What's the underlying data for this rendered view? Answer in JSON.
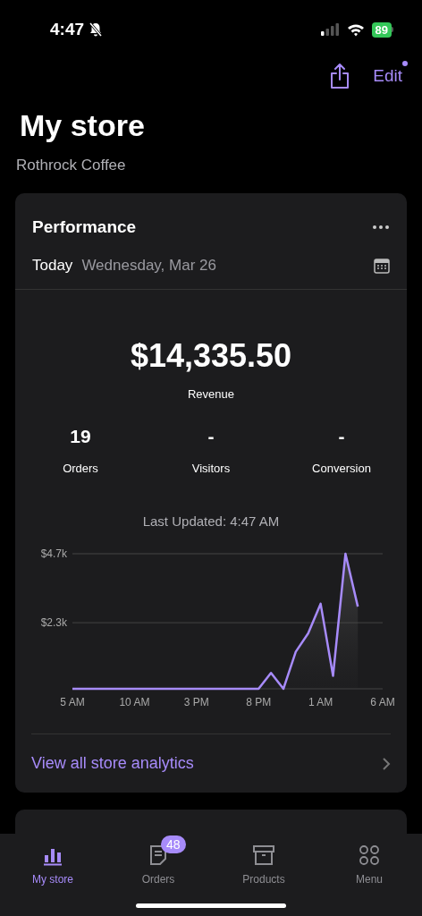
{
  "status_bar": {
    "time": "4:47",
    "battery": "89"
  },
  "header": {
    "edit": "Edit",
    "edit_dot": true
  },
  "title": "My store",
  "subtitle": "Rothrock Coffee",
  "performance": {
    "title": "Performance",
    "period": "Today",
    "date": "Wednesday, Mar 26",
    "revenue": "$14,335.50",
    "revenue_label": "Revenue",
    "stats": [
      {
        "value": "19",
        "label": "Orders"
      },
      {
        "value": "-",
        "label": "Visitors"
      },
      {
        "value": "-",
        "label": "Conversion"
      }
    ],
    "last_updated": "Last Updated: 4:47 AM",
    "chart_data": {
      "type": "area",
      "categories": [
        "5 AM",
        null,
        null,
        null,
        null,
        "10 AM",
        null,
        null,
        null,
        null,
        "3 PM",
        null,
        null,
        null,
        null,
        "8 PM",
        null,
        null,
        null,
        null,
        "1 AM",
        null,
        null,
        null,
        null,
        "6 AM"
      ],
      "ylim": [
        0,
        4700
      ],
      "yticks": [
        {
          "value": 2300,
          "label": "$2.3k"
        },
        {
          "value": 4700,
          "label": "$4.7k"
        }
      ],
      "series": [
        {
          "color": "#a78bfa",
          "values": [
            0,
            0,
            0,
            0,
            0,
            0,
            0,
            0,
            0,
            0,
            0,
            0,
            0,
            0,
            0,
            0,
            550,
            0,
            1290,
            1930,
            2960,
            450,
            4700,
            2860,
            null,
            null
          ]
        }
      ]
    },
    "link": "View all store analytics"
  },
  "tabs": [
    {
      "label": "My store",
      "selected": true
    },
    {
      "label": "Orders",
      "selected": false,
      "badge": "48"
    },
    {
      "label": "Products",
      "selected": false
    },
    {
      "label": "Menu",
      "selected": false
    }
  ]
}
